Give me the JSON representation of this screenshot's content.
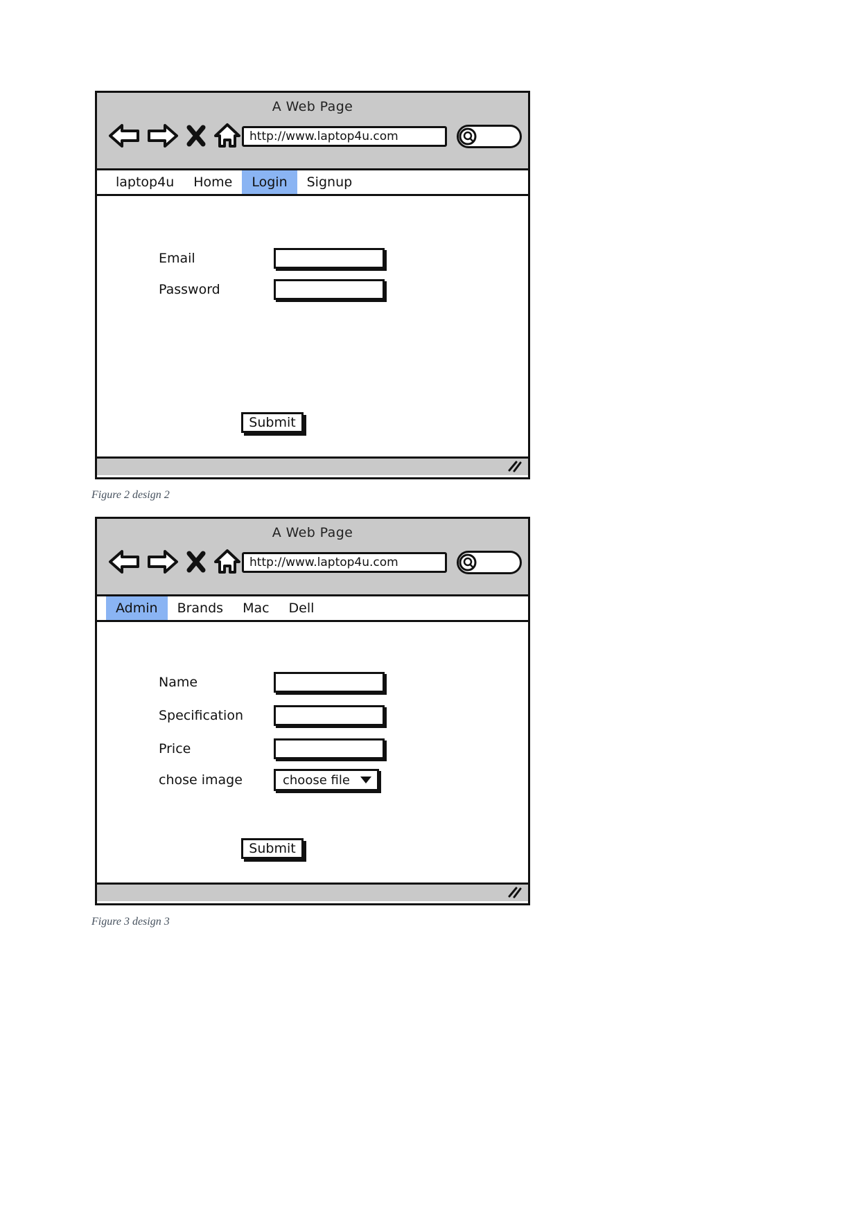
{
  "document": {
    "background_color": "#ffffff"
  },
  "figures": [
    {
      "id": "figure-2",
      "caption": "Figure 2 design 2",
      "browser": {
        "window_title": "A Web Page",
        "url": "http://www.laptop4u.com",
        "icons": {
          "back": "back-arrow-icon",
          "forward": "forward-arrow-icon",
          "stop": "close-x-icon",
          "home": "home-icon",
          "search": "search-magnifier-icon"
        },
        "search_placeholder": ""
      },
      "tabs": [
        {
          "label": "laptop4u",
          "active": false
        },
        {
          "label": "Home",
          "active": false
        },
        {
          "label": "Login",
          "active": true
        },
        {
          "label": "Signup",
          "active": false
        }
      ],
      "form": {
        "fields": [
          {
            "label": "Email",
            "type": "text",
            "value": ""
          },
          {
            "label": "Password",
            "type": "text",
            "value": ""
          }
        ],
        "submit_label": "Submit"
      }
    },
    {
      "id": "figure-3",
      "caption": "Figure 3 design 3",
      "browser": {
        "window_title": "A Web Page",
        "url": "http://www.laptop4u.com",
        "icons": {
          "back": "back-arrow-icon",
          "forward": "forward-arrow-icon",
          "stop": "close-x-icon",
          "home": "home-icon",
          "search": "search-magnifier-icon"
        },
        "search_placeholder": ""
      },
      "tabs": [
        {
          "label": "Admin",
          "active": true
        },
        {
          "label": "Brands",
          "active": false
        },
        {
          "label": "Mac",
          "active": false
        },
        {
          "label": "Dell",
          "active": false
        }
      ],
      "form": {
        "fields": [
          {
            "label": "Name",
            "type": "text",
            "value": ""
          },
          {
            "label": "Specification",
            "type": "text",
            "value": ""
          },
          {
            "label": "Price",
            "type": "text",
            "value": ""
          },
          {
            "label": "chose image",
            "type": "select",
            "value": "choose file"
          }
        ],
        "submit_label": "Submit"
      }
    }
  ],
  "colors": {
    "chrome_gray": "#c9c9c9",
    "active_tab_blue": "#8ab4f3",
    "ink": "#111111",
    "caption_gray": "#46515e"
  }
}
